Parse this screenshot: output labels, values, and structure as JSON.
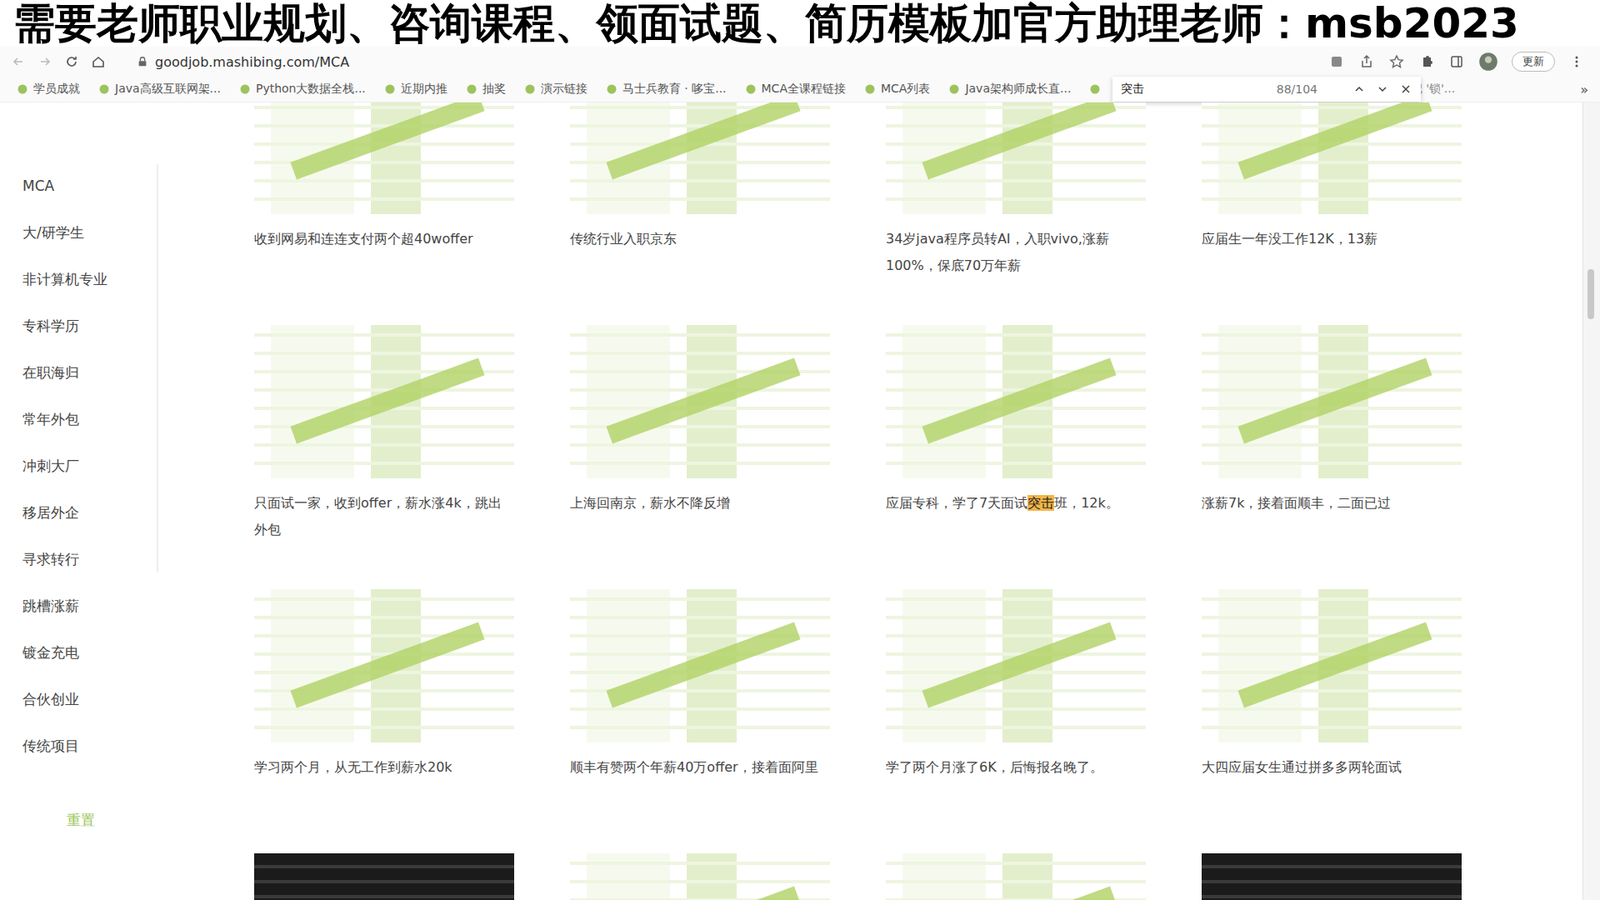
{
  "banner": "需要老师职业规划、咨询课程、领面试题、简历模板加官方助理老师：msb2023",
  "browser": {
    "url": "goodjob.mashibing.com/MCA",
    "update_button": "更新",
    "bookmarks": [
      "学员成就",
      "Java高级互联网架...",
      "Python大数据全栈...",
      "近期内推",
      "抽奖",
      "演示链接",
      "马士兵教育 · 哆宝...",
      "MCA全课程链接",
      "MCA列表",
      "Java架构师成长直..."
    ],
    "bookmark_right": "写把 '锁'...",
    "overflow": "»"
  },
  "find_bar": {
    "query": "突击",
    "count": "88/104"
  },
  "sidebar": {
    "items": [
      {
        "label": "MCA",
        "selected": false
      },
      {
        "label": "大/研学生",
        "selected": false
      },
      {
        "label": "非计算机专业",
        "selected": false
      },
      {
        "label": "专科学历",
        "selected": false
      },
      {
        "label": "在职海归",
        "selected": false
      },
      {
        "label": "常年外包",
        "selected": false
      },
      {
        "label": "冲刺大厂",
        "selected": false
      },
      {
        "label": "移居外企",
        "selected": false
      },
      {
        "label": "寻求转行",
        "selected": false
      },
      {
        "label": "跳槽涨薪",
        "selected": false
      },
      {
        "label": "镀金充电",
        "selected": false
      },
      {
        "label": "合伙创业",
        "selected": false
      },
      {
        "label": "传统项目",
        "selected": false
      }
    ],
    "reset": "重置"
  },
  "cards": [
    {
      "caption": "收到网易和连连支付两个超40woffer",
      "kind": "light",
      "match": ""
    },
    {
      "caption": "传统行业入职京东",
      "kind": "light",
      "match": ""
    },
    {
      "caption": "34岁java程序员转AI，入职vivo,涨薪100%，保底70万年薪",
      "kind": "light",
      "match": ""
    },
    {
      "caption": "应届生一年没工作12K，13薪",
      "kind": "light",
      "match": ""
    },
    {
      "caption": "只面试一家，收到offer，薪水涨4k，跳出外包",
      "kind": "light",
      "match": ""
    },
    {
      "caption": "上海回南京，薪水不降反增",
      "kind": "light",
      "match": ""
    },
    {
      "caption": "应届专科，学了7天面试突击班，12k。",
      "kind": "light",
      "match": "突击"
    },
    {
      "caption": "涨薪7k，接着面顺丰，二面已过",
      "kind": "light",
      "match": ""
    },
    {
      "caption": "学习两个月，从无工作到薪水20k",
      "kind": "light",
      "match": ""
    },
    {
      "caption": "顺丰有赞两个年薪40万offer，接着面阿里",
      "kind": "light",
      "match": ""
    },
    {
      "caption": "学了两个月涨了6K，后悔报名晚了。",
      "kind": "light",
      "match": ""
    },
    {
      "caption": "大四应届女生通过拼多多两轮面试",
      "kind": "light",
      "match": ""
    },
    {
      "caption": "",
      "kind": "dark",
      "match": ""
    },
    {
      "caption": "",
      "kind": "light",
      "match": ""
    },
    {
      "caption": "",
      "kind": "light",
      "match": ""
    },
    {
      "caption": "",
      "kind": "dark",
      "match": ""
    }
  ]
}
